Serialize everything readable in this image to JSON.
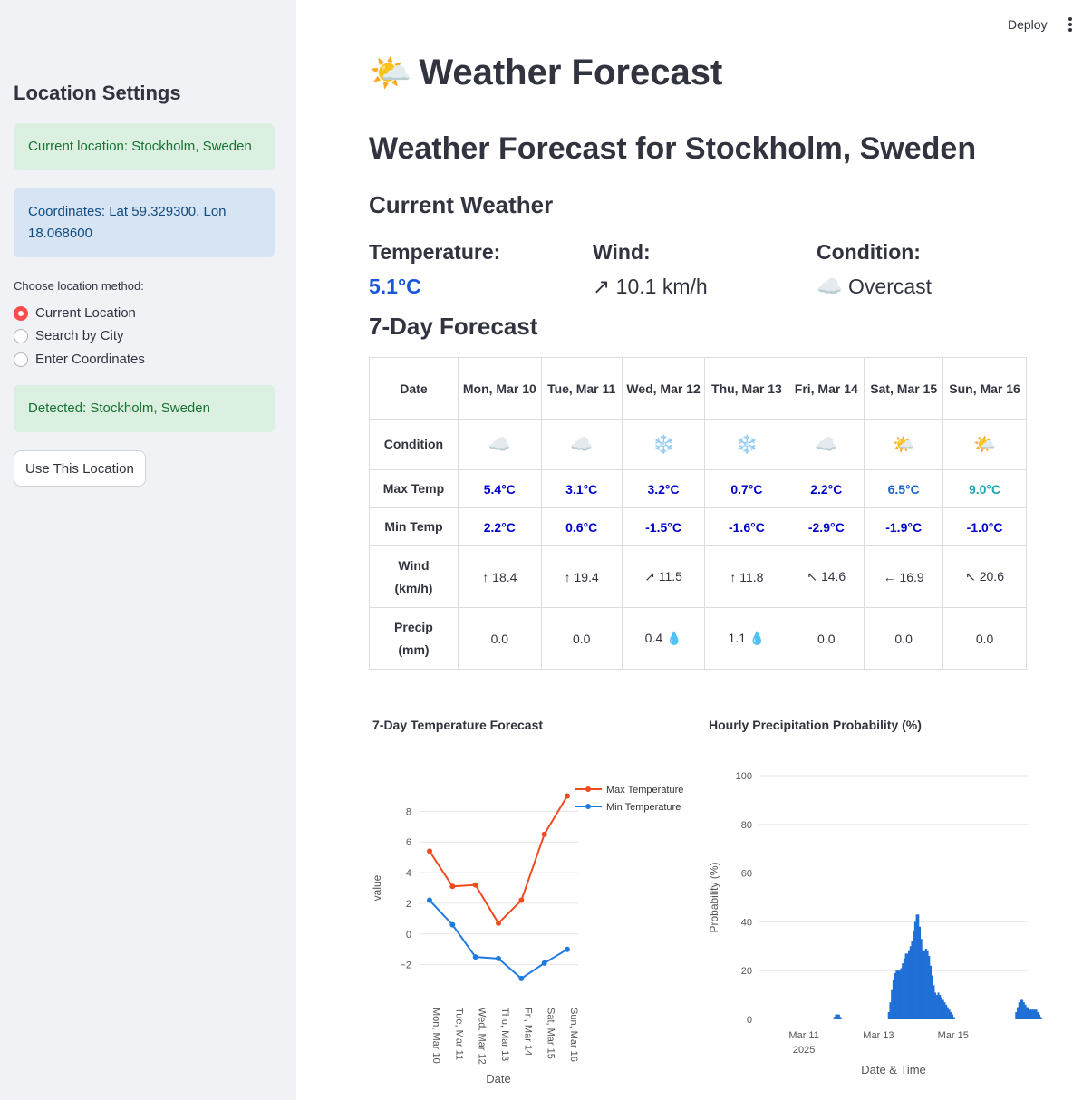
{
  "sidebar": {
    "title": "Location Settings",
    "current_location": "Current location: Stockholm, Sweden",
    "coordinates": "Coordinates: Lat 59.329300, Lon 18.068600",
    "method_label": "Choose location method:",
    "options": [
      "Current Location",
      "Search by City",
      "Enter Coordinates"
    ],
    "selected_option": "Current Location",
    "detected": "Detected: Stockholm, Sweden",
    "use_button": "Use This Location"
  },
  "topbar": {
    "deploy": "Deploy",
    "menu_icon": "kebab-menu-icon"
  },
  "main": {
    "title_emoji": "🌤️",
    "title": "Weather Forecast",
    "subtitle": "Weather Forecast for Stockholm, Sweden",
    "current_heading": "Current Weather",
    "current": {
      "temp_label": "Temperature:",
      "temp_value": "5.1°C",
      "wind_label": "Wind:",
      "wind_value": "↗ 10.1 km/h",
      "cond_label": "Condition:",
      "cond_value": "☁️ Overcast"
    },
    "forecast_heading": "7-Day Forecast",
    "table": {
      "header": [
        "Date",
        "Mon, Mar 10",
        "Tue, Mar 11",
        "Wed, Mar 12",
        "Thu, Mar 13",
        "Fri, Mar 14",
        "Sat, Mar 15",
        "Sun, Mar 16"
      ],
      "rows": {
        "condition": {
          "label": "Condition",
          "values": [
            "☁️",
            "☁️",
            "❄️",
            "❄️",
            "☁️",
            "🌤️",
            "🌤️"
          ]
        },
        "max_temp": {
          "label": "Max Temp",
          "values": [
            "5.4°C",
            "3.1°C",
            "3.2°C",
            "0.7°C",
            "2.2°C",
            "6.5°C",
            "9.0°C"
          ]
        },
        "min_temp": {
          "label": "Min Temp",
          "values": [
            "2.2°C",
            "0.6°C",
            "-1.5°C",
            "-1.6°C",
            "-2.9°C",
            "-1.9°C",
            "-1.0°C"
          ]
        },
        "wind": {
          "label": "Wind (km/h)",
          "values": [
            "↑ 18.4",
            "↑ 19.4",
            "↗ 11.5",
            "↑ 11.8",
            "↖ 14.6",
            "← 16.9",
            "↖ 20.6"
          ]
        },
        "precip": {
          "label": "Precip (mm)",
          "values": [
            "0.0",
            "0.0",
            "0.4 💧",
            "1.1 💧",
            "0.0",
            "0.0",
            "0.0"
          ]
        }
      }
    }
  },
  "colors": {
    "accent": "#ff4b4b",
    "max_line": "#ef4b1f",
    "min_line": "#1f7be0",
    "bars": "#1f6fd6"
  },
  "chart_data": [
    {
      "type": "line",
      "title": "7-Day Temperature Forecast",
      "xlabel": "Date",
      "ylabel": "value",
      "categories": [
        "Mon, Mar 10",
        "Tue, Mar 11",
        "Wed, Mar 12",
        "Thu, Mar 13",
        "Fri, Mar 14",
        "Sat, Mar 15",
        "Sun, Mar 16"
      ],
      "series": [
        {
          "name": "Max Temperature",
          "values": [
            5.4,
            3.1,
            3.2,
            0.7,
            2.2,
            6.5,
            9.0
          ]
        },
        {
          "name": "Min Temperature",
          "values": [
            2.2,
            0.6,
            -1.5,
            -1.6,
            -2.9,
            -1.9,
            -1.0
          ]
        }
      ],
      "yticks": [
        -2,
        0,
        2,
        4,
        6,
        8
      ],
      "ylim": [
        -3.5,
        9.5
      ],
      "legend": "right",
      "grid": true
    },
    {
      "type": "bar",
      "title": "Hourly Precipitation Probability (%)",
      "xlabel": "Date & Time",
      "ylabel": "Probability (%)",
      "xticks": [
        "Mar 11\n2025",
        "Mar 13",
        "Mar 15"
      ],
      "ylim": [
        0,
        100
      ],
      "yticks": [
        0,
        20,
        40,
        60,
        80,
        100
      ],
      "start_hour": "2025-03-10 00:00",
      "values": [
        0,
        0,
        0,
        0,
        0,
        0,
        0,
        0,
        0,
        0,
        0,
        0,
        0,
        0,
        0,
        0,
        0,
        0,
        0,
        0,
        0,
        0,
        0,
        0,
        0,
        0,
        0,
        0,
        0,
        0,
        0,
        0,
        0,
        0,
        0,
        0,
        0,
        0,
        0,
        0,
        0,
        0,
        0,
        1,
        2,
        2,
        2,
        1,
        0,
        0,
        0,
        0,
        0,
        0,
        0,
        0,
        0,
        0,
        0,
        0,
        0,
        0,
        0,
        0,
        0,
        0,
        0,
        0,
        0,
        0,
        0,
        0,
        0,
        0,
        0,
        0,
        0,
        0,
        3,
        7,
        12,
        16,
        19,
        20,
        20,
        20,
        21,
        23,
        25,
        27,
        27,
        28,
        30,
        32,
        36,
        40,
        43,
        43,
        38,
        33,
        28,
        28,
        29,
        28,
        26,
        22,
        18,
        14,
        11,
        10,
        11,
        10,
        9,
        8,
        7,
        6,
        5,
        4,
        3,
        2,
        1,
        0,
        0,
        0,
        0,
        0,
        0,
        0,
        0,
        0,
        0,
        0,
        0,
        0,
        0,
        0,
        0,
        0,
        0,
        0,
        0,
        0,
        0,
        0,
        0,
        0,
        0,
        0,
        0,
        0,
        0,
        0,
        0,
        0,
        0,
        0,
        0,
        0,
        0,
        0,
        3,
        5,
        7,
        8,
        8,
        7,
        6,
        5,
        5,
        4,
        4,
        4,
        4,
        4,
        3,
        2,
        1
      ]
    }
  ]
}
